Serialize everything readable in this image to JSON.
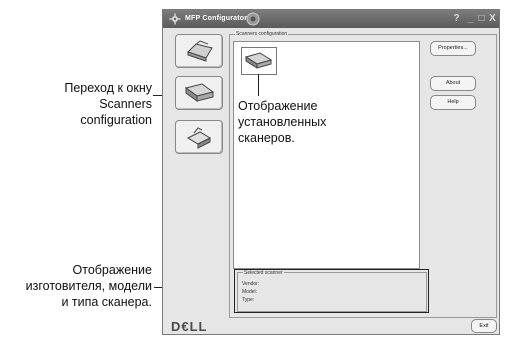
{
  "annotations": {
    "nav": [
      "Переход к окну",
      "Scanners configuration"
    ],
    "list": [
      "Отображение",
      "установленных",
      "сканеров."
    ],
    "selected": [
      "Отображение",
      "изготовителя, модели",
      "и типа сканера."
    ]
  },
  "window": {
    "title": "MFP Configurator",
    "controls": {
      "help": "?",
      "minimize": "_",
      "maximize": "□",
      "close": "X"
    }
  },
  "group_label": "Scanners configuration",
  "buttons": {
    "properties": "Properties...",
    "about": "About",
    "help": "Help",
    "exit": "Exit"
  },
  "selected_scanner": {
    "label": "Selected scanner",
    "vendor": "Vendor:",
    "model": "Model:",
    "type": "Type:"
  },
  "brand": "D€LL",
  "icons": [
    "printer-icon",
    "scanner-icon",
    "port-icon",
    "scanner-thumbnail-icon"
  ]
}
